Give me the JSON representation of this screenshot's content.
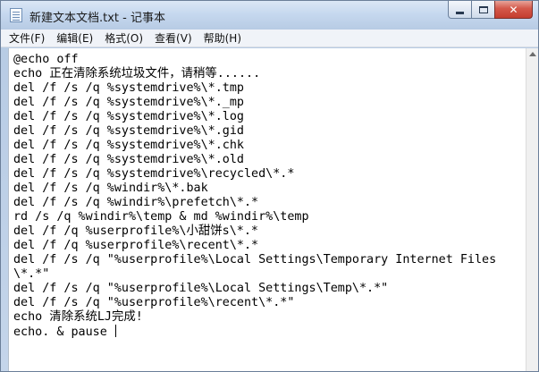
{
  "window": {
    "title": "新建文本文档.txt - 记事本",
    "app_icon": "notepad-icon",
    "buttons": {
      "minimize_icon": "minimize-icon",
      "maximize_icon": "maximize-icon",
      "close_icon": "close-icon",
      "close_glyph": "✕"
    }
  },
  "menubar": {
    "items": [
      {
        "label": "文件(F)"
      },
      {
        "label": "编辑(E)"
      },
      {
        "label": "格式(O)"
      },
      {
        "label": "查看(V)"
      },
      {
        "label": "帮助(H)"
      }
    ]
  },
  "editor": {
    "lines": [
      "@echo off",
      "echo 正在清除系统垃圾文件，请稍等......",
      "del /f /s /q %systemdrive%\\*.tmp",
      "del /f /s /q %systemdrive%\\*._mp",
      "del /f /s /q %systemdrive%\\*.log",
      "del /f /s /q %systemdrive%\\*.gid",
      "del /f /s /q %systemdrive%\\*.chk",
      "del /f /s /q %systemdrive%\\*.old",
      "del /f /s /q %systemdrive%\\recycled\\*.*",
      "del /f /s /q %windir%\\*.bak",
      "del /f /s /q %windir%\\prefetch\\*.*",
      "rd /s /q %windir%\\temp & md %windir%\\temp",
      "del /f /q %userprofile%\\小甜饼s\\*.*",
      "del /f /q %userprofile%\\recent\\*.*",
      "del /f /s /q \"%userprofile%\\Local Settings\\Temporary Internet Files",
      "\\*.*\"",
      "del /f /s /q \"%userprofile%\\Local Settings\\Temp\\*.*\"",
      "del /f /s /q \"%userprofile%\\recent\\*.*\"",
      "echo 清除系统LJ完成!",
      "echo. & pause "
    ]
  },
  "colors": {
    "titlebar": "#c6d8ef",
    "close_button": "#d4584a",
    "editor_background": "#ffffff",
    "text": "#000000"
  }
}
